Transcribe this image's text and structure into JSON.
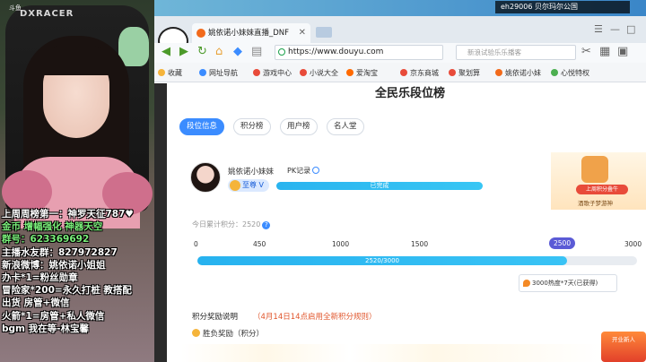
{
  "webcam": {
    "chair_brand": "DXRACER",
    "stand_logo": "斗鱼",
    "overlay_lines": [
      {
        "text": "上周周榜第一：神罗天征787♥",
        "color": "white"
      },
      {
        "text": "金币  增幅强化  神器天空",
        "color": "green"
      },
      {
        "text": "群号：623369692",
        "color": "green"
      },
      {
        "text": "主播水友群：827972827",
        "color": "white"
      },
      {
        "text": "新浪微博：姚依诺小姐姐",
        "color": "white"
      },
      {
        "text": "办卡*1=粉丝勋章",
        "color": "white"
      },
      {
        "text": "冒险家*200=永久打桩  教搭配",
        "color": "white"
      },
      {
        "text": "               出货  房管+微信",
        "color": "white"
      },
      {
        "text": "火箭*1=房管+私人微信",
        "color": "white"
      },
      {
        "text": "bgm  我在等-林宝馨",
        "color": "white"
      }
    ]
  },
  "top_overlay": {
    "nick": "eh29006 贝尔玛尔公国"
  },
  "browser": {
    "tab_title": "姚依诺小妹妹直播_DNF",
    "tab_close": "✕",
    "url": "https://www.douyu.com",
    "search_placeholder": "新浪试验乐乐播客",
    "bookmarks": [
      {
        "label": "收藏",
        "color": "#f5b43a"
      },
      {
        "label": "网址导航",
        "color": "#3b8cff"
      },
      {
        "label": "游戏中心",
        "color": "#e84b3a"
      },
      {
        "label": "小说大全",
        "color": "#e84b3a"
      },
      {
        "label": "爱淘宝",
        "color": "#ff6a00"
      },
      {
        "label": "京东商城",
        "color": "#e84b3a"
      },
      {
        "label": "聚划算",
        "color": "#e84b3a"
      },
      {
        "label": "姚依诺小妹",
        "color": "#f26a1b"
      },
      {
        "label": "心悦特权",
        "color": "#4caf50"
      }
    ],
    "window_buttons": [
      "☰",
      "—",
      "□"
    ]
  },
  "page": {
    "title": "全民乐段位榜",
    "tabs": [
      {
        "label": "段位信息",
        "active": true
      },
      {
        "label": "积分榜",
        "active": false
      },
      {
        "label": "用户榜",
        "active": false
      },
      {
        "label": "名人堂",
        "active": false
      }
    ],
    "user": {
      "name": "姚依诺小妹妹",
      "pk_label": "PK记录",
      "rank_label": "至尊 V",
      "pk_status": "已完成",
      "pk_progress": 1.0
    },
    "promo": {
      "button": "上周积分叠牛",
      "subtitle": "酒歌子梦游神"
    },
    "score": {
      "today_label": "今日累计积分：2520",
      "ticks": [
        "0",
        "450",
        "1000",
        "1500",
        "3000"
      ],
      "current_tick": "2500",
      "progress_text": "2520/3000",
      "current": 2520,
      "max": 3000,
      "reward_text": "3000热度*7天(已获得)"
    },
    "rules": {
      "title": "积分奖励说明",
      "note": "（4月14日14点启用全新积分规则）",
      "win_lose": "胜负奖励（积分）"
    },
    "corner_ad": "开业新人"
  }
}
